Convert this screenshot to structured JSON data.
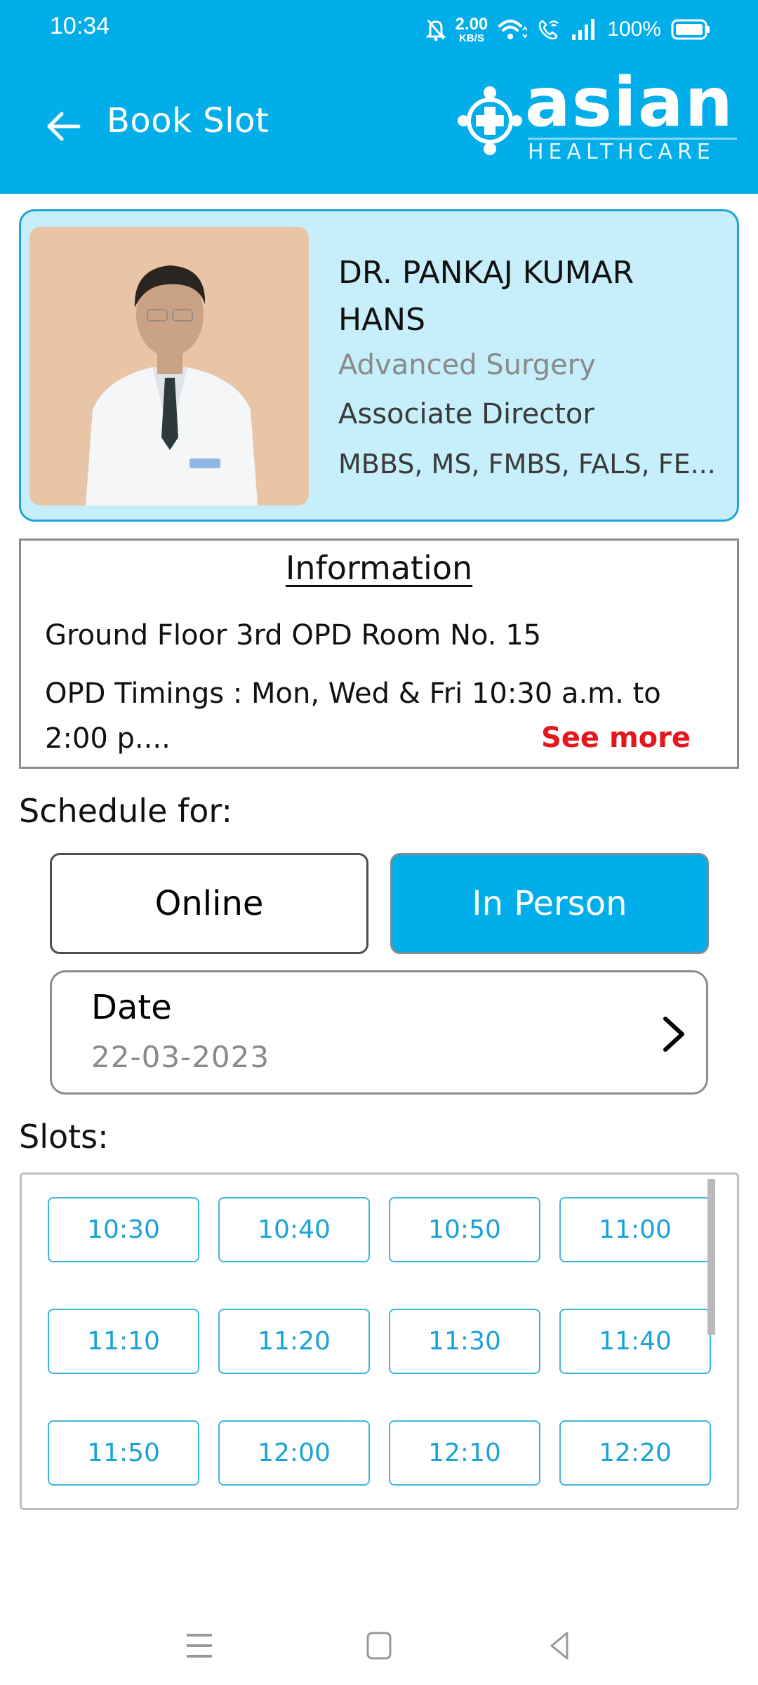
{
  "status_bar": {
    "time": "10:34",
    "net_speed_value": "2.00",
    "net_speed_unit": "KB/S",
    "battery": "100%"
  },
  "header": {
    "title": "Book Slot",
    "back_icon": "arrow-left-icon",
    "logo_word": "asian",
    "logo_sub": "HEALTHCARE",
    "background_color": "#02aeea"
  },
  "doctor": {
    "name": "DR. PANKAJ KUMAR HANS",
    "specialty": "Advanced Surgery",
    "designation": "Associate Director",
    "qualifications": "MBBS, MS, FMBS, FALS, FE..."
  },
  "information": {
    "title": "Information",
    "location": "Ground Floor 3rd OPD Room No. 15",
    "timings": "OPD Timings : Mon, Wed & Fri 10:30 a.m. to 2:00 p....",
    "see_more": "See more",
    "see_more_color": "#e5171c"
  },
  "schedule": {
    "label": "Schedule for:",
    "options": [
      {
        "label": "Online",
        "selected": false
      },
      {
        "label": "In Person",
        "selected": true
      }
    ],
    "date_label": "Date",
    "date_value": "22-03-2023"
  },
  "slots": {
    "label": "Slots:",
    "times": [
      "10:30",
      "10:40",
      "10:50",
      "11:00",
      "11:10",
      "11:20",
      "11:30",
      "11:40",
      "11:50",
      "12:00",
      "12:10",
      "12:20"
    ],
    "accent_color": "#1aa3d7"
  },
  "nav_bar": {
    "items": [
      "recents-icon",
      "home-icon",
      "back-icon"
    ]
  }
}
